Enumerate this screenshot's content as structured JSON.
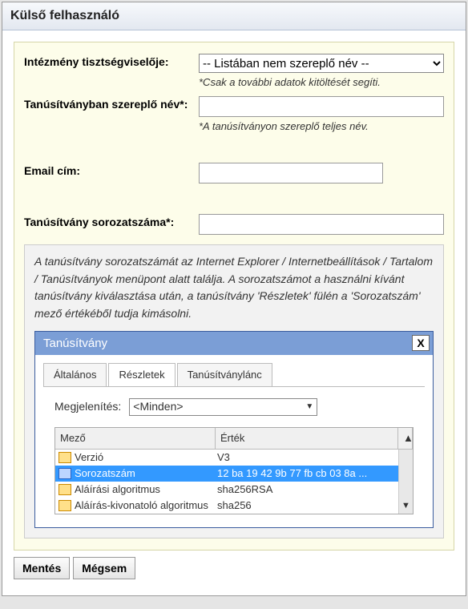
{
  "dialog": {
    "title": "Külső felhasználó"
  },
  "form": {
    "institution": {
      "label": "Intézmény tisztségviselője:",
      "selected": "-- Listában nem szereplő név --",
      "hint": "*Csak a további adatok kitöltését segíti."
    },
    "certName": {
      "label": "Tanúsítványban szereplő név*:",
      "hint": "*A tanúsítványon szereplő teljes név."
    },
    "email": {
      "label": "Email cím:"
    },
    "serial": {
      "label": "Tanúsítvány sorozatszáma*:"
    }
  },
  "help": {
    "text": "A tanúsítvány sorozatszámát az Internet Explorer / Internetbeállítások / Tartalom / Tanúsítványok menüpont alatt találja. A sorozatszámot a használni kívánt tanúsítvány kiválasztása után, a tanúsítvány 'Részletek' fülén a 'Sorozatszám' mező értékéből tudja kimásolni."
  },
  "cert": {
    "title": "Tanúsítvány",
    "close": "X",
    "tabs": {
      "general": "Általános",
      "details": "Részletek",
      "chain": "Tanúsítványlánc",
      "active": "details"
    },
    "display": {
      "label": "Megjelenítés:",
      "value": "<Minden>"
    },
    "columns": {
      "field": "Mező",
      "value": "Érték"
    },
    "rows": [
      {
        "field": "Verzió",
        "value": "V3",
        "selected": false
      },
      {
        "field": "Sorozatszám",
        "value": "12 ba 19 42 9b 77 fb cb 03 8a ...",
        "selected": true
      },
      {
        "field": "Aláírási algoritmus",
        "value": "sha256RSA",
        "selected": false
      },
      {
        "field": "Aláírás-kivonatoló algoritmus",
        "value": "sha256",
        "selected": false
      }
    ]
  },
  "buttons": {
    "save": "Mentés",
    "cancel": "Mégsem"
  }
}
